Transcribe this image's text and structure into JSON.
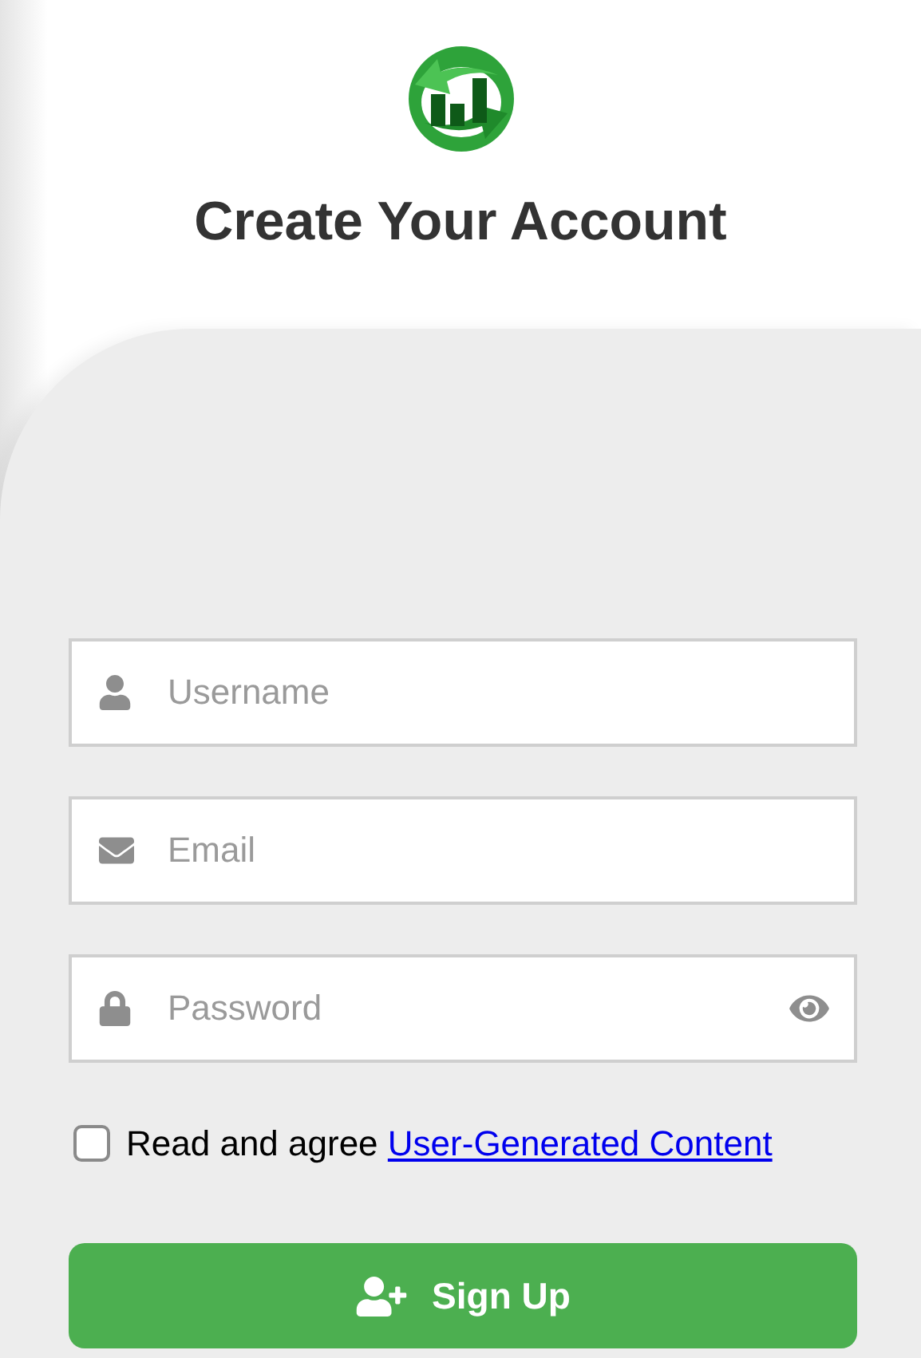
{
  "title": "Create Your Account",
  "fields": [
    {
      "kind": "username",
      "placeholder": "Username"
    },
    {
      "kind": "email",
      "placeholder": "Email"
    },
    {
      "kind": "password",
      "placeholder": "Password"
    }
  ],
  "agreement": {
    "checked": false,
    "text": "Read and agree",
    "link": "User-Generated Content"
  },
  "submit": {
    "label": "Sign Up"
  }
}
